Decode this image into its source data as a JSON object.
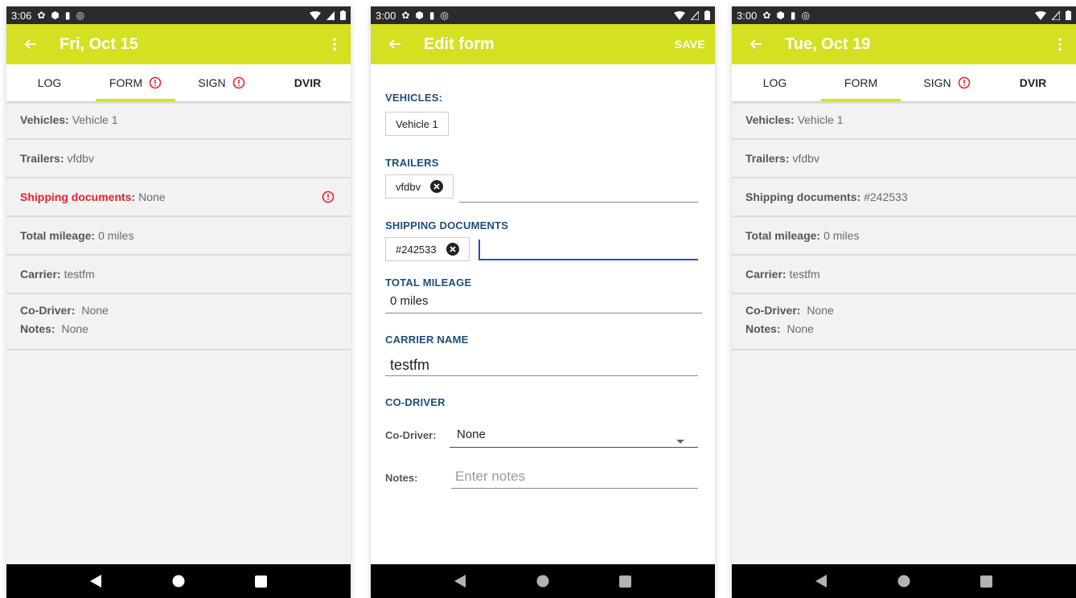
{
  "screens": {
    "first": {
      "status_time": "3:06",
      "title": "Fri, Oct 15",
      "tabs": [
        "LOG",
        "FORM",
        "SIGN",
        "DVIR"
      ],
      "rows": {
        "vehicles": {
          "label": "Vehicles:",
          "value": "Vehicle 1"
        },
        "trailers": {
          "label": "Trailers:",
          "value": "vfdbv"
        },
        "shipping": {
          "label": "Shipping documents:",
          "value": "None"
        },
        "mileage": {
          "label": "Total mileage:",
          "value": "0 miles"
        },
        "carrier": {
          "label": "Carrier:",
          "value": "testfm"
        },
        "codriver": {
          "label": "Co-Driver:",
          "value": "None"
        },
        "notes": {
          "label": "Notes:",
          "value": "None"
        }
      }
    },
    "edit": {
      "status_time": "3:00",
      "title": "Edit form",
      "save_label": "SAVE",
      "sections": {
        "vehicles": "VEHICLES:",
        "trailers": "TRAILERS",
        "shipping": "SHIPPING DOCUMENTS",
        "mileage": "TOTAL MILEAGE",
        "carrier": "CARRIER NAME",
        "codriver": "CO-DRIVER"
      },
      "vehicle_chip": "Vehicle 1",
      "trailer_chip": "vfdbv",
      "shipping_chip": "#242533",
      "mileage_value": "0 miles",
      "carrier_value": "testfm",
      "codriver_label": "Co-Driver:",
      "codriver_value": "None",
      "notes_label": "Notes:",
      "notes_placeholder": "Enter notes"
    },
    "second": {
      "status_time": "3:00",
      "title": "Tue, Oct 19",
      "tabs": [
        "LOG",
        "FORM",
        "SIGN",
        "DVIR"
      ],
      "rows": {
        "vehicles": {
          "label": "Vehicles:",
          "value": "Vehicle 1"
        },
        "trailers": {
          "label": "Trailers:",
          "value": "vfdbv"
        },
        "shipping": {
          "label": "Shipping documents:",
          "value": "#242533"
        },
        "mileage": {
          "label": "Total mileage:",
          "value": "0 miles"
        },
        "carrier": {
          "label": "Carrier:",
          "value": "testfm"
        },
        "codriver": {
          "label": "Co-Driver:",
          "value": "None"
        },
        "notes": {
          "label": "Notes:",
          "value": "None"
        }
      }
    }
  },
  "icons": {
    "back": "arrow-left-icon",
    "menu": "more-vert-icon",
    "alert": "alert-circle-icon",
    "remove": "close-circle-icon",
    "dropdown": "caret-down-icon",
    "nav_back": "triangle-back-icon",
    "nav_home": "circle-home-icon",
    "nav_recents": "square-recents-icon"
  },
  "colors": {
    "accent": "#d4e021",
    "status_bar": "#2b2b2b",
    "error": "#e8232b",
    "section_label": "#1f4d7a",
    "focus": "#2d45c7",
    "content_bg": "#f2f2f2"
  }
}
